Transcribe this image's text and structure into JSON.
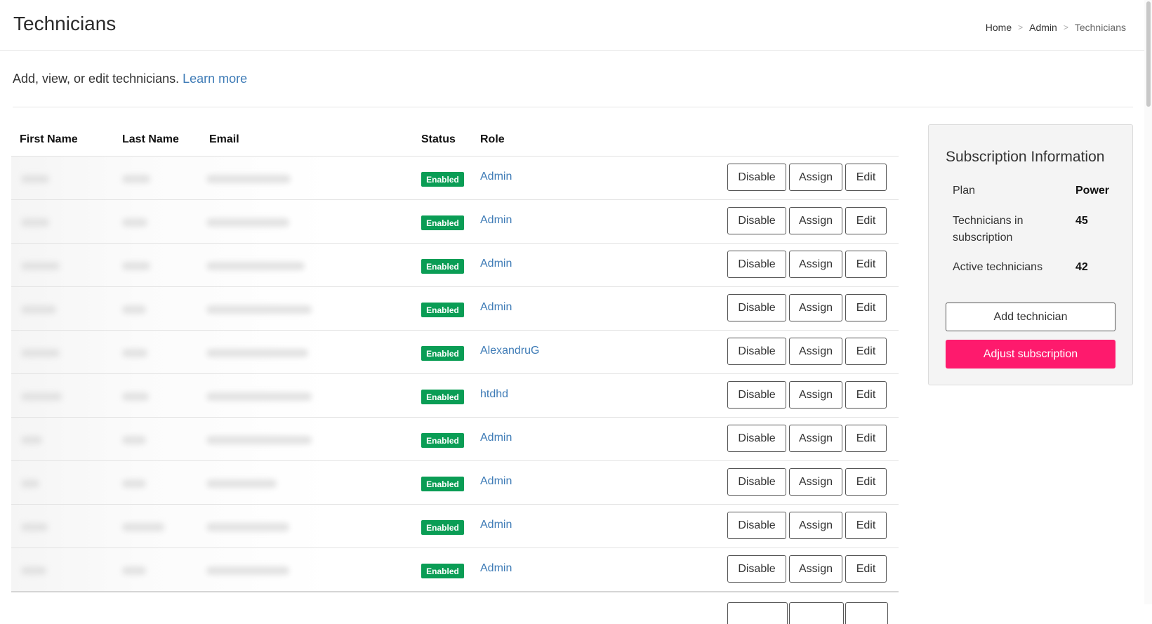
{
  "header": {
    "title": "Technicians",
    "breadcrumb": [
      {
        "label": "Home"
      },
      {
        "label": "Admin"
      },
      {
        "label": "Technicians"
      }
    ],
    "separator": ">"
  },
  "intro": {
    "text": "Add, view, or edit technicians.",
    "link": "Learn more"
  },
  "table": {
    "columns": {
      "first_name": "First Name",
      "last_name": "Last Name",
      "email": "Email",
      "status": "Status",
      "role": "Role"
    },
    "rows": [
      {
        "status": "Enabled",
        "role": "Admin"
      },
      {
        "status": "Enabled",
        "role": "Admin"
      },
      {
        "status": "Enabled",
        "role": "Admin"
      },
      {
        "status": "Enabled",
        "role": "Admin"
      },
      {
        "status": "Enabled",
        "role": "AlexandruG"
      },
      {
        "status": "Enabled",
        "role": "htdhd"
      },
      {
        "status": "Enabled",
        "role": "Admin"
      },
      {
        "status": "Enabled",
        "role": "Admin"
      },
      {
        "status": "Enabled",
        "role": "Admin"
      },
      {
        "status": "Enabled",
        "role": "Admin"
      }
    ],
    "actions": {
      "disable": "Disable",
      "assign": "Assign",
      "edit": "Edit"
    }
  },
  "subscription": {
    "title": "Subscription Information",
    "plan_label": "Plan",
    "plan_value": "Power",
    "technicians_label": "Technicians in subscription",
    "technicians_value": "45",
    "active_label": "Active technicians",
    "active_value": "42",
    "add_button": "Add technician",
    "adjust_button": "Adjust subscription"
  },
  "colors": {
    "accent_link": "#3e7bb6",
    "status_enabled": "#0a9d55",
    "primary_button": "#fe1a6d"
  }
}
